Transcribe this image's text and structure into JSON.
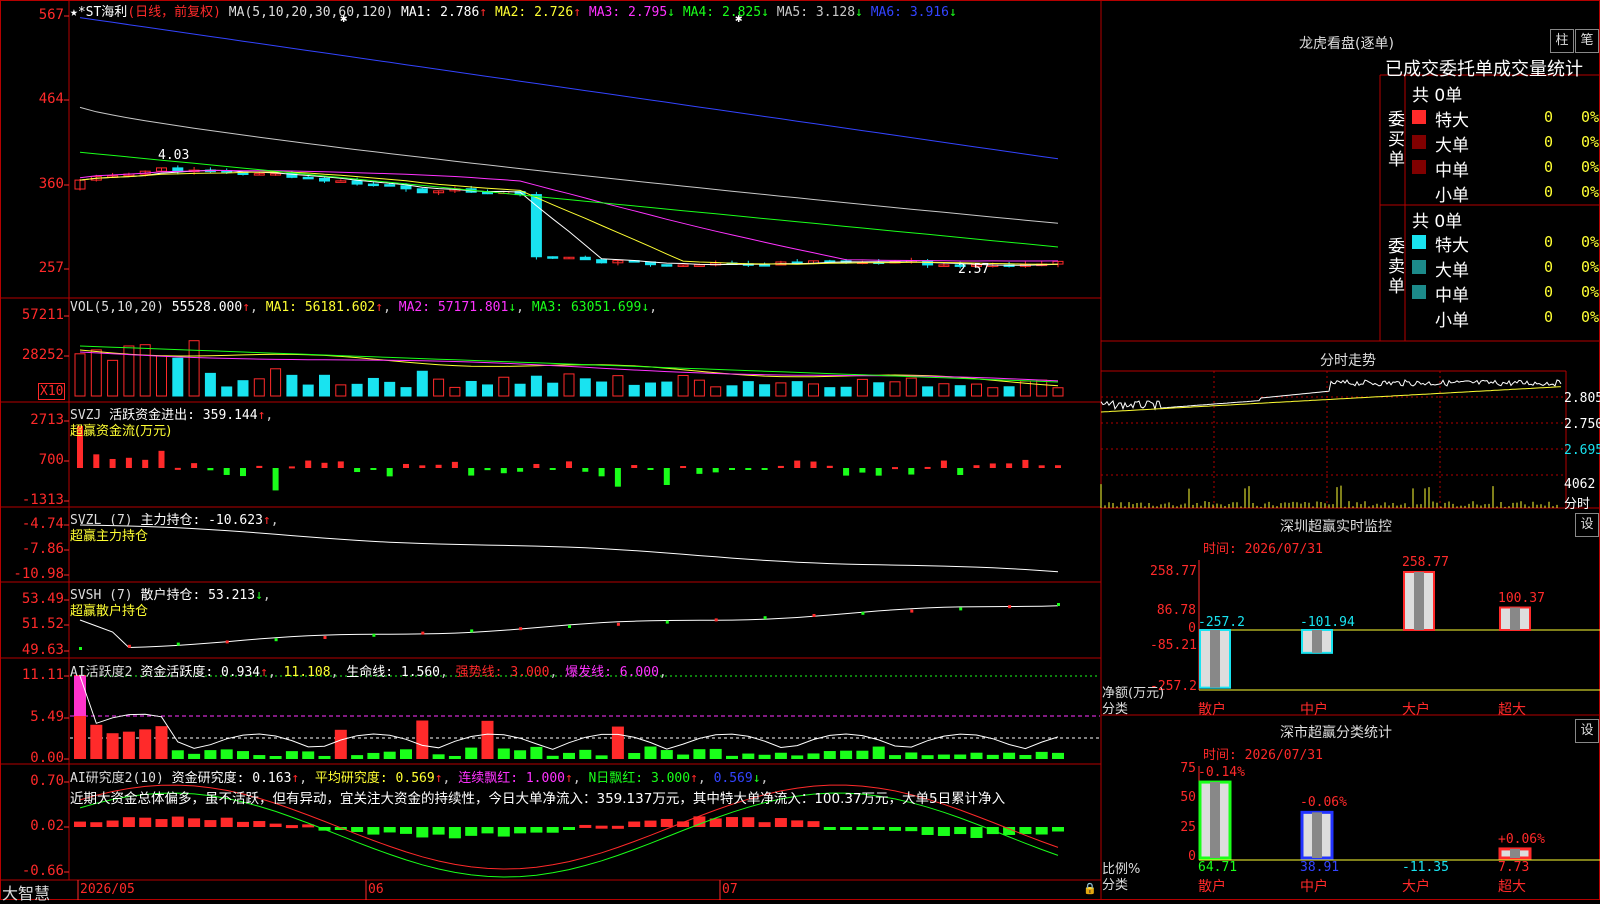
{
  "colors": {
    "up": "#ff2a2a",
    "down": "#19e3f0",
    "green": "#1aff1a",
    "yellow": "#ffff33",
    "magenta": "#ff33ff",
    "white": "#ffffff",
    "blue": "#3344ff",
    "grey": "#c8c8c8",
    "grid": "#b40000",
    "darkred": "#800000",
    "teal": "#1c8a8a"
  },
  "kline": {
    "title": "★*ST海利",
    "period": "(日线，前复权)",
    "ma_header": "MA(5,10,20,30,60,120)",
    "ma": [
      {
        "label": "MA1:",
        "value": "2.786",
        "arrow": "↑",
        "color": "#ffffff"
      },
      {
        "label": "MA2:",
        "value": "2.726",
        "arrow": "↑",
        "color": "#ffff33"
      },
      {
        "label": "MA3:",
        "value": "2.795",
        "arrow": "↓",
        "color": "#ff33ff"
      },
      {
        "label": "MA4:",
        "value": "2.825",
        "arrow": "↓",
        "color": "#1aff1a"
      },
      {
        "label": "MA5:",
        "value": "3.128",
        "arrow": "↓",
        "color": "#c8c8c8"
      },
      {
        "label": "MA6:",
        "value": "3.916",
        "arrow": "↓",
        "color": "#3344ff"
      }
    ],
    "y_ticks": [
      "567",
      "464",
      "360",
      "257"
    ],
    "high_mark": "4.03",
    "low_mark": "2.57"
  },
  "vol": {
    "header": "VOL(5,10,20)",
    "value": "55528.000",
    "arrow": "↑",
    "ma": [
      {
        "label": "MA1:",
        "value": "56181.602",
        "arrow": "↑",
        "color": "#ffff33"
      },
      {
        "label": "MA2:",
        "value": "57171.801",
        "arrow": "↓",
        "color": "#ff33ff"
      },
      {
        "label": "MA3:",
        "value": "63051.699",
        "arrow": "↓",
        "color": "#1aff1a"
      }
    ],
    "y_ticks": [
      "57211",
      "28252"
    ],
    "unit": "X10"
  },
  "svzj": {
    "header": "SVZJ",
    "name": "活跃资金进出:",
    "value": "359.144",
    "arrow": "↑",
    "subtitle": "超赢资金流(万元)",
    "y_ticks": [
      "2713",
      "700",
      "-1313"
    ]
  },
  "svzl": {
    "header": "SVZL (7)",
    "name": "主力持仓:",
    "value": "-10.623",
    "arrow": "↑",
    "subtitle": "超赢主力持仓",
    "y_ticks": [
      "-4.74",
      "-7.86",
      "-10.98"
    ]
  },
  "svsh": {
    "header": "SVSH (7)",
    "name": "散户持仓:",
    "value": "53.213",
    "arrow": "↓",
    "subtitle": "超赢散户持仓",
    "y_ticks": [
      "53.49",
      "51.52",
      "49.63"
    ]
  },
  "ai_active": {
    "header": "AI活跃度2",
    "items": [
      {
        "label": "资金活跃度:",
        "value": "0.934",
        "arrow": "↑",
        "color": "#ffffff"
      },
      {
        "label": "",
        "value": "11.108",
        "arrow": "",
        "color": "#ffff33"
      },
      {
        "label": "生命线:",
        "value": "1.560",
        "arrow": "",
        "color": "#ffffff"
      },
      {
        "label": "强势线:",
        "value": "3.000",
        "arrow": "",
        "color": "#ff2a2a"
      },
      {
        "label": "爆发线:",
        "value": "6.000",
        "arrow": "",
        "color": "#ff33ff"
      }
    ],
    "y_ticks": [
      "11.11",
      "5.49",
      "0.00"
    ]
  },
  "ai_research": {
    "header": "AI研究度2(10)",
    "items": [
      {
        "label": "资金研究度:",
        "value": "0.163",
        "arrow": "↑",
        "color": "#ffffff"
      },
      {
        "label": "平均研究度:",
        "value": "0.569",
        "arrow": "↑",
        "color": "#ffff33"
      },
      {
        "label": "连续飘红:",
        "value": "1.000",
        "arrow": "↑",
        "color": "#ff33ff"
      },
      {
        "label": "N日飘红:",
        "value": "3.000",
        "arrow": "↑",
        "color": "#1aff1a"
      },
      {
        "label": "",
        "value": "0.569",
        "arrow": "↓",
        "color": "#3344ff"
      }
    ],
    "comment": "近期大资金总体偏多，虽不活跃，但有异动，宜关注大资金的持续性，今日大单净流入：359.137万元，其中特大单净流入：100.37万元，大单5日累计净入",
    "y_ticks": [
      "0.70",
      "0.02",
      "-0.66"
    ]
  },
  "xaxis": {
    "brand": "大智慧",
    "labels": [
      "2026/05",
      "06",
      "07"
    ]
  },
  "dragon": {
    "title": "龙虎看盘(逐单)",
    "btn1": "柱",
    "btn2": "笔",
    "section_title": "已成交委托单成交量统计",
    "buy_side": "委买单",
    "sell_side": "委卖单",
    "buy_total": "共 0单",
    "sell_total": "共 0单",
    "buy_rows": [
      {
        "name": "特大",
        "qty": "0",
        "pct": "0%",
        "color": "#ff2a2a"
      },
      {
        "name": "大单",
        "qty": "0",
        "pct": "0%",
        "color": "#800000"
      },
      {
        "name": "中单",
        "qty": "0",
        "pct": "0%",
        "color": "#800000"
      },
      {
        "name": "小单",
        "qty": "0",
        "pct": "0%",
        "color": ""
      }
    ],
    "sell_rows": [
      {
        "name": "特大",
        "qty": "0",
        "pct": "0%",
        "color": "#19e3f0"
      },
      {
        "name": "大单",
        "qty": "0",
        "pct": "0%",
        "color": "#1c8a8a"
      },
      {
        "name": "中单",
        "qty": "0",
        "pct": "0%",
        "color": "#1c8a8a"
      },
      {
        "name": "小单",
        "qty": "0",
        "pct": "0%",
        "color": ""
      }
    ]
  },
  "intraday": {
    "title": "分时走势",
    "y_ticks": [
      "2.805",
      "2.750",
      "2.695"
    ],
    "vol_tick": "4062",
    "vol_unit": "分时"
  },
  "monitor": {
    "title": "深圳超赢实时监控",
    "btn": "设",
    "time": "时间: 2026/07/31",
    "y_ticks": [
      "258.77",
      "86.78",
      "0",
      "-85.21",
      "-257.2"
    ],
    "ylabel": "净额(万元)",
    "xlabel": "分类",
    "cats": [
      "散户",
      "中户",
      "大户",
      "超大"
    ],
    "values": [
      -257.2,
      -101.94,
      258.77,
      100.37
    ],
    "labels": [
      "-257.2",
      "-101.94",
      "258.77",
      "100.37"
    ]
  },
  "classify": {
    "title": "深市超赢分类统计",
    "btn": "设",
    "time": "时间: 2026/07/31",
    "y_ticks": [
      "75",
      "50",
      "25",
      "0"
    ],
    "ylabel": "比例%",
    "xlabel": "分类",
    "cats": [
      "散户",
      "中户",
      "大户",
      "超大"
    ],
    "values": [
      64.71,
      38.91,
      -11.35,
      7.73
    ],
    "bottom_labels": [
      "64.71",
      "38.91",
      "-11.35",
      "7.73"
    ],
    "top_labels": [
      "-0.14%",
      "-0.06%",
      "",
      "+0.06%"
    ]
  }
}
